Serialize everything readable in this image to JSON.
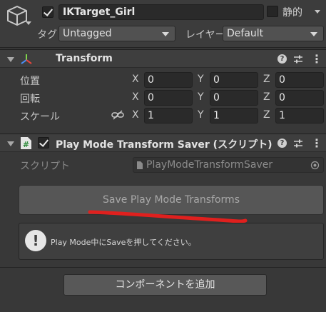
{
  "gameobject": {
    "name": "IKTarget_Girl",
    "active": true,
    "static_label": "静的",
    "static_checked": false,
    "tag_label": "タグ",
    "tag_value": "Untagged",
    "layer_label": "レイヤー",
    "layer_value": "Default"
  },
  "transform": {
    "title": "Transform",
    "rows": [
      {
        "label": "位置",
        "x": "0",
        "y": "0",
        "z": "0"
      },
      {
        "label": "回転",
        "x": "0",
        "y": "0",
        "z": "0"
      },
      {
        "label": "スケール",
        "x": "1",
        "y": "1",
        "z": "1"
      }
    ],
    "axis_labels": {
      "x": "X",
      "y": "Y",
      "z": "Z"
    }
  },
  "script_component": {
    "title": "Play Mode Transform Saver (スクリプト)",
    "enabled": true,
    "script_label": "スクリプト",
    "script_value": "PlayModeTransformSaver",
    "save_button_label": "Save Play Mode Transforms",
    "help_message": "Play Mode中にSaveを押してください。",
    "annotation_color": "#e0201e"
  },
  "add_component_label": "コンポーネントを追加",
  "icons": {
    "gameobject": "cube-icon",
    "transform": "transform-axes-icon",
    "script": "script-hash-icon",
    "help": "help-icon",
    "presets": "sliders-icon",
    "menu": "kebab-menu-icon",
    "link": "chain-link-icon",
    "info": "info-icon",
    "target": "object-picker-icon"
  }
}
